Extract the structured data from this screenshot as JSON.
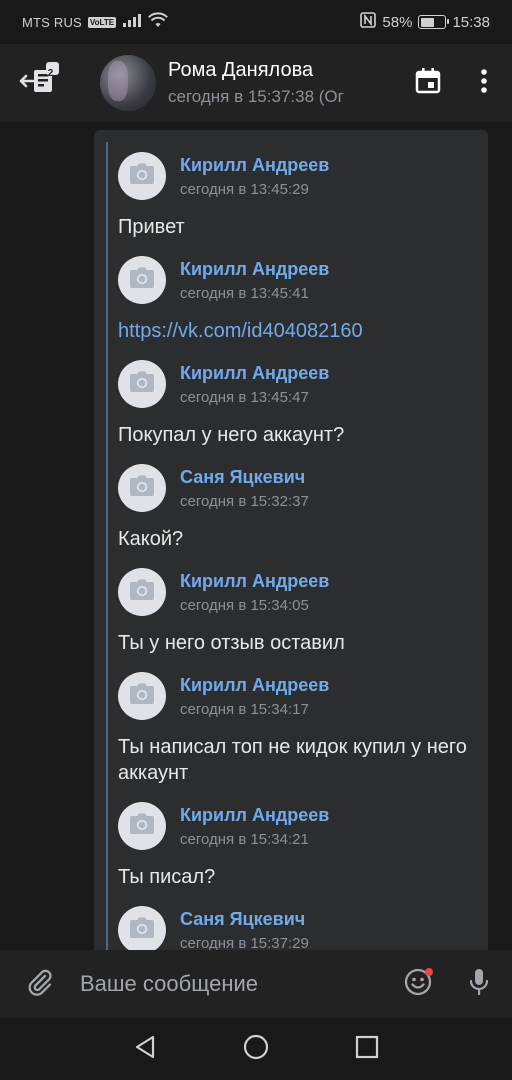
{
  "status_bar": {
    "carrier": "MTS RUS",
    "volte": "VoLTE",
    "battery": "58%",
    "battery_level": 0.58,
    "time": "15:38"
  },
  "header": {
    "back_badge": "2",
    "name": "Рома Данялова",
    "last_seen": "сегодня в 15:37:38 (Ог"
  },
  "messages": [
    {
      "author": "Кирилл Андреев",
      "time": "сегодня в 13:45:29",
      "text": "Привет"
    },
    {
      "author": "Кирилл Андреев",
      "time": "сегодня в 13:45:41",
      "text": "https://vk.com/id404082160",
      "link": true
    },
    {
      "author": "Кирилл Андреев",
      "time": "сегодня в 13:45:47",
      "text": "Покупал у него аккаунт?"
    },
    {
      "author": "Саня Яцкевич",
      "time": "сегодня в 15:32:37",
      "text": "Какой?"
    },
    {
      "author": "Кирилл Андреев",
      "time": "сегодня в 15:34:05",
      "text": "Ты у него отзыв оставил"
    },
    {
      "author": "Кирилл Андреев",
      "time": "сегодня в 15:34:17",
      "text": "Ты написал топ не кидок купил у него аккаунт"
    },
    {
      "author": "Кирилл Андреев",
      "time": "сегодня в 15:34:21",
      "text": "Ты писал?"
    },
    {
      "author": "Саня Яцкевич",
      "time": "сегодня в 15:37:29",
      "text": ""
    }
  ],
  "composer": {
    "placeholder": "Ваше сообщение"
  },
  "colors": {
    "link": "#71aaeb",
    "background": "#19191a",
    "card": "#2c2d2e",
    "notification_dot": "#e64646"
  },
  "icons": {
    "back": "back-arrow-icon",
    "calendar": "calendar-icon",
    "more": "more-vertical-icon",
    "attach": "paperclip-icon",
    "emoji": "emoji-icon",
    "mic": "microphone-icon",
    "camera": "camera-icon"
  }
}
